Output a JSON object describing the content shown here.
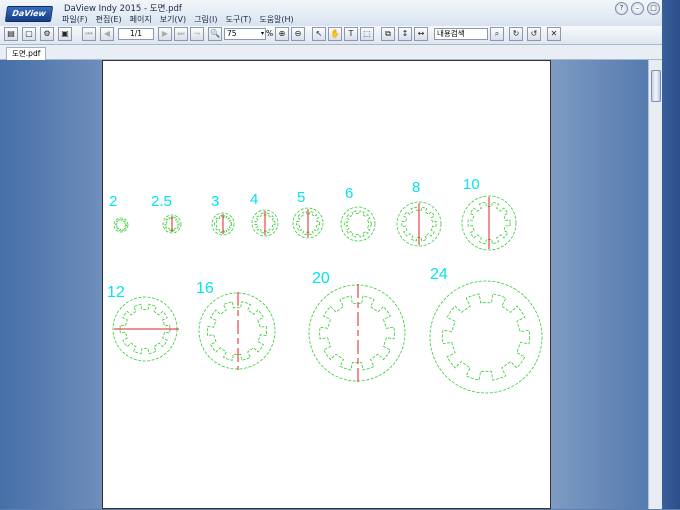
{
  "app": {
    "logo": "DaView",
    "title": "DaView Indy 2015 - 도면.pdf"
  },
  "menu": [
    "파일(F)",
    "편집(E)",
    "페이지",
    "보기(V)",
    "그림(I)",
    "도구(T)",
    "도움말(H)"
  ],
  "toolbar": {
    "page_indicator": "1/1",
    "zoom_value": "75",
    "zoom_unit": "%",
    "search_placeholder": "내용검색"
  },
  "tabs": [
    {
      "label": "도면.pdf"
    }
  ],
  "drawing": {
    "labels": [
      "2",
      "2.5",
      "3",
      "4",
      "5",
      "6",
      "8",
      "10",
      "12",
      "16",
      "20",
      "24"
    ],
    "label_color": "#00e5ee",
    "gear_color": "#33cc33",
    "axis_color": "#e02020"
  }
}
